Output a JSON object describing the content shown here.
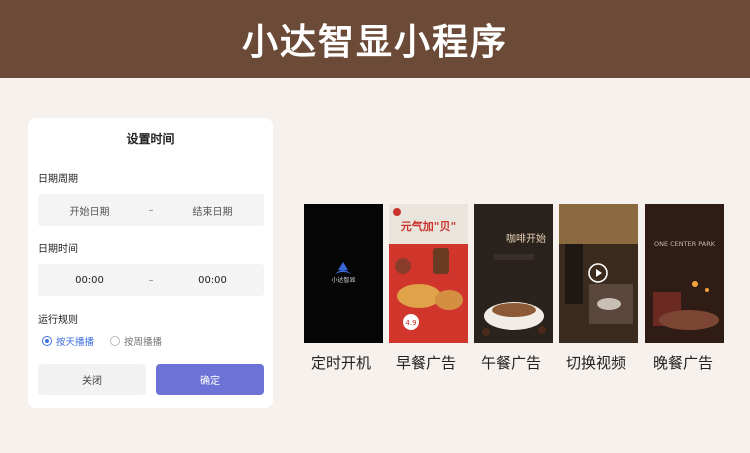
{
  "banner": {
    "title": "小达智显小程序"
  },
  "dialog": {
    "title": "设置时间",
    "date_period_label": "日期周期",
    "start_date_placeholder": "开始日期",
    "range_sep": "–",
    "end_date_placeholder": "结束日期",
    "date_time_label": "日期时间",
    "start_time": "00:00",
    "end_time": "00:00",
    "rule_label": "运行规则",
    "options": [
      {
        "label": "按天播播",
        "selected": true
      },
      {
        "label": "按周播播",
        "selected": false
      }
    ],
    "close_label": "关闭",
    "confirm_label": "确定"
  },
  "previews": [
    {
      "label": "定时开机",
      "art_text": "小达智显"
    },
    {
      "label": "早餐广告",
      "art_text": "元气加\"贝\"",
      "price": "4.9"
    },
    {
      "label": "午餐广告",
      "art_text": "咖啡开始"
    },
    {
      "label": "切换视频"
    },
    {
      "label": "晚餐广告",
      "art_text": "ONE CENTER PARK"
    }
  ],
  "colors": {
    "banner_bg": "#6b4a38",
    "accent_blue": "#3e6fe0",
    "confirm_bg": "#6c72d6",
    "page_bg": "#f6f1ed"
  }
}
